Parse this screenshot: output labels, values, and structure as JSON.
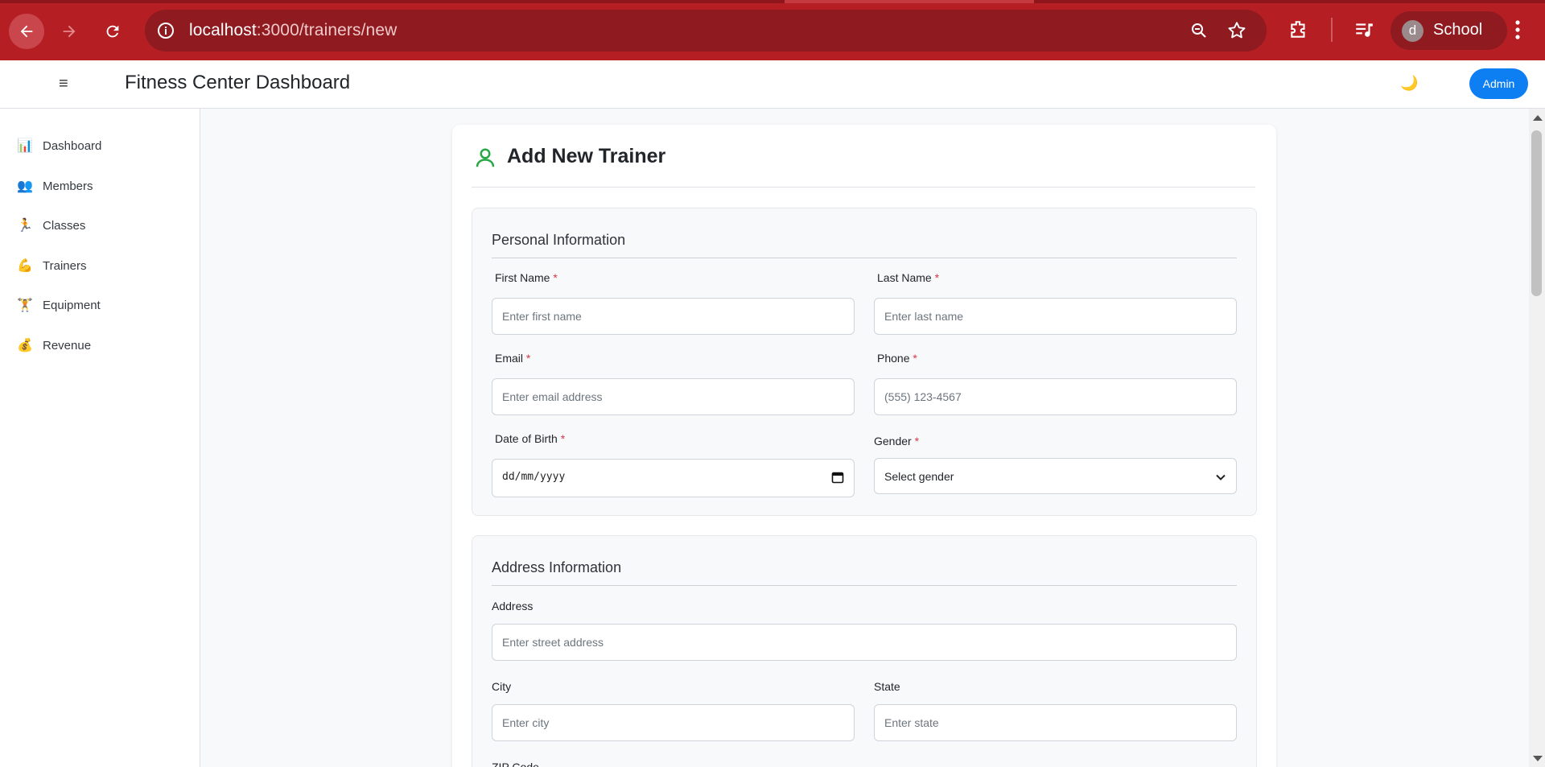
{
  "browser": {
    "url_host": "localhost",
    "url_path": ":3000/trainers/new",
    "profile_initial": "d",
    "profile_name": "School"
  },
  "header": {
    "menu_icon": "≡",
    "title": "Fitness Center Dashboard",
    "theme_icon": "🌙",
    "admin_label": "Admin"
  },
  "sidebar": {
    "items": [
      {
        "icon": "📊",
        "label": "Dashboard"
      },
      {
        "icon": "👥",
        "label": "Members"
      },
      {
        "icon": "🏃",
        "label": "Classes"
      },
      {
        "icon": "💪",
        "label": "Trainers"
      },
      {
        "icon": "🏋",
        "label": "Equipment"
      },
      {
        "icon": "💰",
        "label": "Revenue"
      }
    ]
  },
  "form": {
    "title": "Add New Trainer",
    "required_mark": "*",
    "personal": {
      "heading": "Personal Information",
      "first_name_label": "First Name",
      "first_name_placeholder": "Enter first name",
      "last_name_label": "Last Name",
      "last_name_placeholder": "Enter last name",
      "email_label": "Email",
      "email_placeholder": "Enter email address",
      "phone_label": "Phone",
      "phone_placeholder": "(555) 123-4567",
      "dob_label": "Date of Birth",
      "dob_placeholder": "dd/mm/yyyy",
      "gender_label": "Gender",
      "gender_selected": "Select gender"
    },
    "address": {
      "heading": "Address Information",
      "address_label": "Address",
      "address_placeholder": "Enter street address",
      "city_label": "City",
      "city_placeholder": "Enter city",
      "state_label": "State",
      "state_placeholder": "Enter state",
      "zip_label": "ZIP Code"
    }
  },
  "colors": {
    "browser_frame": "#b51f24",
    "accent": "#0d7ff2",
    "required": "#dc3545",
    "trainer_icon": "#28a745"
  }
}
